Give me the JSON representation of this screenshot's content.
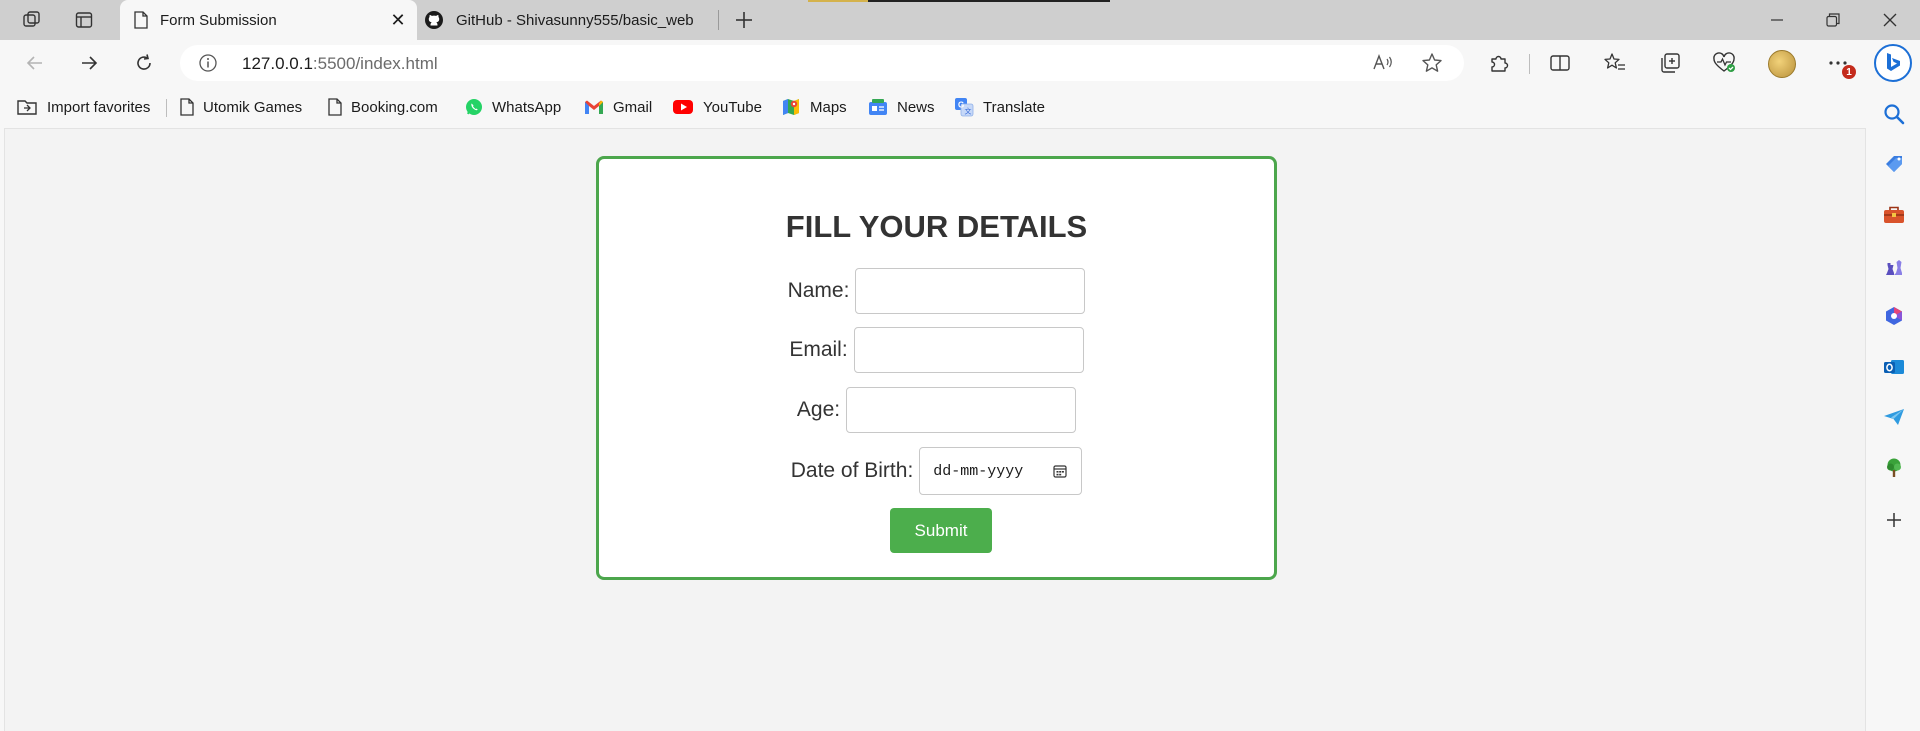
{
  "browser": {
    "tabs": [
      {
        "title": "Form Submission",
        "active": true
      },
      {
        "title": "GitHub - Shivasunny555/basic_web",
        "active": false
      }
    ],
    "address": {
      "host": "127.0.0.1",
      "path": ":5500/index.html"
    },
    "favorites": [
      {
        "label": "Import favorites",
        "icon": "import-icon"
      },
      {
        "label": "Utomik Games",
        "icon": "page-icon"
      },
      {
        "label": "Booking.com",
        "icon": "page-icon"
      },
      {
        "label": "WhatsApp",
        "icon": "whatsapp-icon"
      },
      {
        "label": "Gmail",
        "icon": "gmail-icon"
      },
      {
        "label": "YouTube",
        "icon": "youtube-icon"
      },
      {
        "label": "Maps",
        "icon": "maps-icon"
      },
      {
        "label": "News",
        "icon": "news-icon"
      },
      {
        "label": "Translate",
        "icon": "translate-icon"
      }
    ],
    "notification_badge": "1",
    "colors": {
      "accent_green": "#4ca64c",
      "badge_red": "#c42b1c",
      "bing_blue": "#1c6fd6"
    }
  },
  "form": {
    "title": "FILL YOUR DETAILS",
    "fields": {
      "name": {
        "label": "Name:",
        "value": ""
      },
      "email": {
        "label": "Email:",
        "value": ""
      },
      "age": {
        "label": "Age:",
        "value": ""
      },
      "dob": {
        "label": "Date of Birth:",
        "placeholder": "dd-mm-yyyy"
      }
    },
    "submit_label": "Submit"
  }
}
